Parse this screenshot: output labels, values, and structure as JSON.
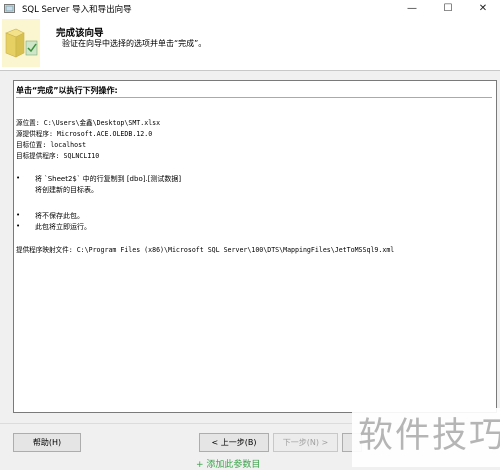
{
  "window": {
    "title": "SQL Server 导入和导出向导",
    "minimize": "—",
    "maximize": "☐",
    "close": "✕"
  },
  "header": {
    "title": "完成该向导",
    "description": "验证在向导中选择的选项并单击“完成”。"
  },
  "summary": {
    "heading": "单击“完成”以执行下列操作:",
    "source_location": "源位置: C:\\Users\\金鑫\\Desktop\\SMT.xlsx",
    "source_provider": "源提供程序: Microsoft.ACE.OLEDB.12.0",
    "target_location": "目标位置: localhost",
    "target_provider": "目标提供程序: SQLNCLI10",
    "bullets": [
      "将 `Sheet2$` 中的行复制到 [dbo].[测试数据]",
      "将不保存此包。",
      "此包将立即运行。"
    ],
    "bullet_sub": "将创建新的目标表。",
    "mapping_file": "提供程序映射文件: C:\\Program Files (x86)\\Microsoft SQL Server\\100\\DTS\\MappingFiles\\JetToMSSql9.xml"
  },
  "buttons": {
    "help": "帮助(H)",
    "back": "< 上一步(B)",
    "next": "下一步(N) >"
  },
  "watermark": "软件技巧",
  "bottom_fragment": "+ 添加此参数目"
}
